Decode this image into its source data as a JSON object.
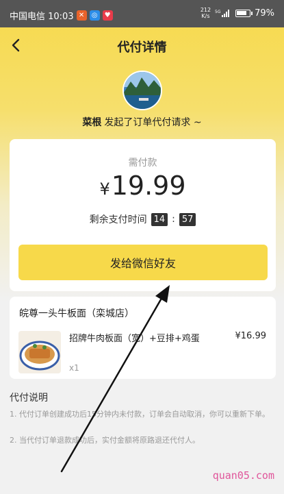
{
  "status_bar": {
    "carrier_time": "中国电信 10:03",
    "net_speed_value": "212",
    "net_speed_unit": "K/s",
    "network": "5G",
    "battery": "79%",
    "battery_level": 0.79
  },
  "header": {
    "title": "代付详情"
  },
  "requester": {
    "name": "菜根",
    "message": "发起了订单代付请求 ~"
  },
  "payment": {
    "amount_label": "需付款",
    "currency": "¥",
    "amount": "19.99",
    "timer_label": "剩余支付时间",
    "timer_minutes": "14",
    "timer_separator": ":",
    "timer_seconds": "57",
    "share_button": "发给微信好友"
  },
  "order": {
    "shop_name": "皖尊一头牛板面（栾城店）",
    "items": [
      {
        "name": "招牌牛肉板面（宽）+豆排+鸡蛋",
        "price": "¥16.99",
        "quantity": "x1"
      }
    ]
  },
  "notes": {
    "title": "代付说明",
    "items": [
      "1. 代付订单创建成功后15分钟内未付款，订单会自动取消，你可以重新下单。",
      "2. 当代付订单退款成功后，实付金额将原路退还代付人。"
    ]
  },
  "watermark": "quan05.com",
  "colors": {
    "accent": "#f7d94a",
    "timer_bg": "#333333",
    "watermark": "#e0559a"
  }
}
